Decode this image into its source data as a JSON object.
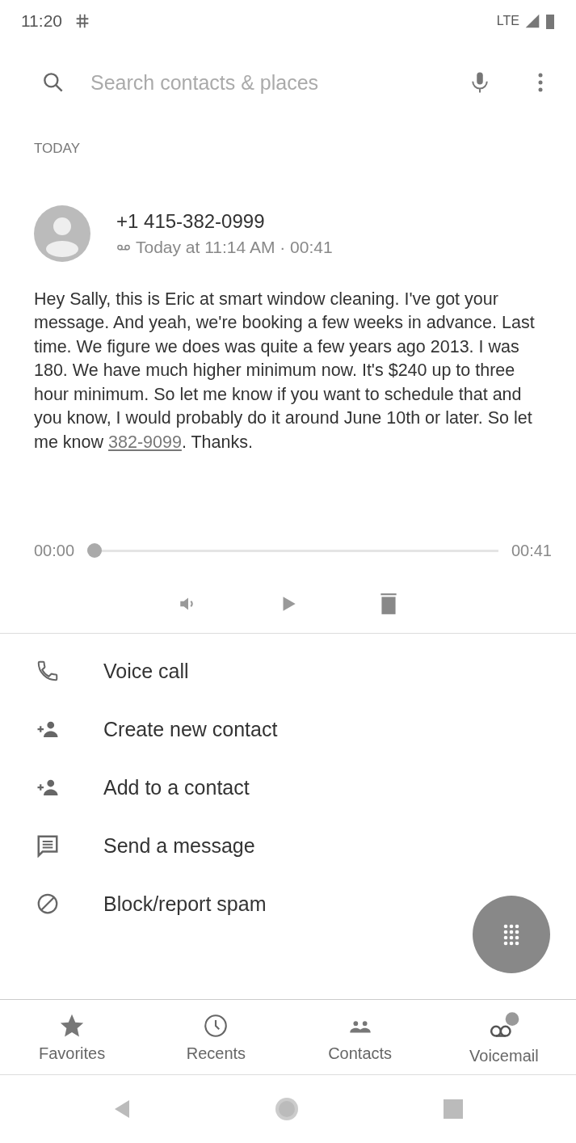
{
  "status_bar": {
    "time": "11:20",
    "network": "LTE"
  },
  "search": {
    "placeholder": "Search contacts & places"
  },
  "section_header": "TODAY",
  "voicemail": {
    "number": "+1 415-382-0999",
    "meta": "Today at 11:14 AM · 00:41",
    "transcript": {
      "before": "Hey Sally, this is Eric at smart window cleaning. I've got your message. And yeah, we're booking a few weeks in advance. Last time. We figure we does was quite a few years ago 2013. I was 180. We have much higher minimum now. It's $240 up to three hour minimum. So let me know if you want to schedule that and you know, I would probably do it around June 10th or later. So let me know ",
      "link": "382-9099",
      "after": ". Thanks."
    },
    "player": {
      "elapsed": "00:00",
      "total": "00:41",
      "level": 0
    }
  },
  "actions": [
    {
      "kind": "call",
      "label": "Voice call"
    },
    {
      "kind": "add-person",
      "label": "Create new contact"
    },
    {
      "kind": "add-person",
      "label": "Add to a contact"
    },
    {
      "kind": "message",
      "label": "Send a message"
    },
    {
      "kind": "block",
      "label": "Block/report spam"
    }
  ],
  "bottom_nav": [
    {
      "kind": "star",
      "label": "Favorites"
    },
    {
      "kind": "clock",
      "label": "Recents"
    },
    {
      "kind": "people",
      "label": "Contacts"
    },
    {
      "kind": "voicemail",
      "label": "Voicemail"
    }
  ]
}
